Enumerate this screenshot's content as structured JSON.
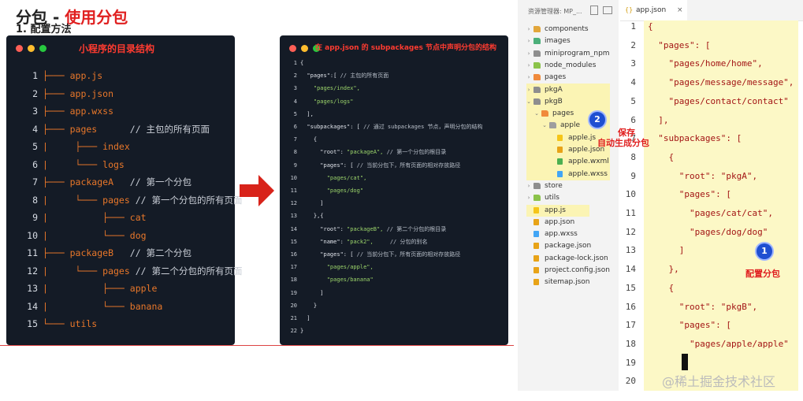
{
  "heading": {
    "part1": "分包 - ",
    "part2": "使用分包"
  },
  "subheading": "1. 配置方法",
  "panel1": {
    "title": "小程序的目录结构",
    "lines": [
      {
        "n": "1",
        "t": "├─── app.js",
        "c": ""
      },
      {
        "n": "2",
        "t": "├─── app.json",
        "c": ""
      },
      {
        "n": "3",
        "t": "├─── app.wxss",
        "c": ""
      },
      {
        "n": "4",
        "t": "├─── pages      ",
        "c": "// 主包的所有页面"
      },
      {
        "n": "5",
        "t": "|     ├─── index",
        "c": ""
      },
      {
        "n": "6",
        "t": "|     └─── logs",
        "c": ""
      },
      {
        "n": "7",
        "t": "├─── packageA   ",
        "c": "// 第一个分包"
      },
      {
        "n": "8",
        "t": "|     └─── pages ",
        "c": "// 第一个分包的所有页面"
      },
      {
        "n": "9",
        "t": "|          ├─── cat",
        "c": ""
      },
      {
        "n": "10",
        "t": "|          └─── dog",
        "c": ""
      },
      {
        "n": "11",
        "t": "├─── packageB   ",
        "c": "// 第二个分包"
      },
      {
        "n": "12",
        "t": "|     └─── pages ",
        "c": "// 第二个分包的所有页面"
      },
      {
        "n": "13",
        "t": "|          ├─── apple",
        "c": ""
      },
      {
        "n": "14",
        "t": "|          └─── banana",
        "c": ""
      },
      {
        "n": "15",
        "t": "└─── utils",
        "c": ""
      }
    ]
  },
  "panel2": {
    "title": "在 app.json 的 subpackages 节点中声明分包的结构",
    "lines": [
      {
        "n": "1",
        "a": "{",
        "s": "",
        "c": ""
      },
      {
        "n": "2",
        "a": "  \"pages\":[ ",
        "s": "",
        "c": "// 主包的所有页面"
      },
      {
        "n": "3",
        "a": "    ",
        "s": "\"pages/index\",",
        "c": ""
      },
      {
        "n": "4",
        "a": "    ",
        "s": "\"pages/logs\"",
        "c": ""
      },
      {
        "n": "5",
        "a": "  ],",
        "s": "",
        "c": ""
      },
      {
        "n": "6",
        "a": "  \"subpackages\": [ ",
        "s": "",
        "c": "// 通过 subpackages 节点，声明分包的结构"
      },
      {
        "n": "7",
        "a": "    {",
        "s": "",
        "c": ""
      },
      {
        "n": "8",
        "a": "      \"root\": ",
        "s": "\"packageA\", ",
        "c": "// 第一个分包的根目录"
      },
      {
        "n": "9",
        "a": "      \"pages\": [ ",
        "s": "",
        "c": "// 当前分包下，所有页面的相对存放路径"
      },
      {
        "n": "10",
        "a": "        ",
        "s": "\"pages/cat\",",
        "c": ""
      },
      {
        "n": "11",
        "a": "        ",
        "s": "\"pages/dog\"",
        "c": ""
      },
      {
        "n": "12",
        "a": "      ]",
        "s": "",
        "c": ""
      },
      {
        "n": "13",
        "a": "    },{",
        "s": "",
        "c": ""
      },
      {
        "n": "14",
        "a": "      \"root\": ",
        "s": "\"packageB\", ",
        "c": "// 第二个分包的根目录"
      },
      {
        "n": "15",
        "a": "      \"name\": ",
        "s": "\"pack2\",     ",
        "c": "// 分包的别名"
      },
      {
        "n": "16",
        "a": "      \"pages\": [ ",
        "s": "",
        "c": "// 当前分包下，所有页面的相对存放路径"
      },
      {
        "n": "17",
        "a": "        ",
        "s": "\"pages/apple\",",
        "c": ""
      },
      {
        "n": "18",
        "a": "        ",
        "s": "\"pages/banana\"",
        "c": ""
      },
      {
        "n": "19",
        "a": "      ]",
        "s": "",
        "c": ""
      },
      {
        "n": "20",
        "a": "    }",
        "s": "",
        "c": ""
      },
      {
        "n": "21",
        "a": "  ]",
        "s": "",
        "c": ""
      },
      {
        "n": "22",
        "a": "}",
        "s": "",
        "c": ""
      }
    ]
  },
  "explorer": {
    "header": "资源管理器: MP_...",
    "items": [
      {
        "label": "components",
        "depth": 0,
        "chev": "›",
        "icon": "folder",
        "color": "#e2a63b"
      },
      {
        "label": "images",
        "depth": 0,
        "chev": "›",
        "icon": "folder",
        "color": "#4caf7a"
      },
      {
        "label": "miniprogram_npm",
        "depth": 0,
        "chev": "›",
        "icon": "folder",
        "color": "#8e8e8e"
      },
      {
        "label": "node_modules",
        "depth": 0,
        "chev": "›",
        "icon": "folder",
        "color": "#8bc34a"
      },
      {
        "label": "pages",
        "depth": 0,
        "chev": "›",
        "icon": "folder",
        "color": "#f08a3c"
      },
      {
        "label": "pkgA",
        "depth": 0,
        "chev": "›",
        "icon": "folder",
        "color": "#8e8e8e"
      },
      {
        "label": "pkgB",
        "depth": 0,
        "chev": "⌄",
        "icon": "folder",
        "color": "#8e8e8e"
      },
      {
        "label": "pages",
        "depth": 1,
        "chev": "⌄",
        "icon": "folder",
        "color": "#f08a3c"
      },
      {
        "label": "apple",
        "depth": 2,
        "chev": "⌄",
        "icon": "folder",
        "color": "#9e9e9e"
      },
      {
        "label": "apple.js",
        "depth": 3,
        "chev": "",
        "icon": "file",
        "color": "#f5c518"
      },
      {
        "label": "apple.json",
        "depth": 3,
        "chev": "",
        "icon": "file",
        "color": "#e8a317"
      },
      {
        "label": "apple.wxml",
        "depth": 3,
        "chev": "",
        "icon": "file",
        "color": "#4caf50"
      },
      {
        "label": "apple.wxss",
        "depth": 3,
        "chev": "",
        "icon": "file",
        "color": "#42a5f5"
      },
      {
        "label": "store",
        "depth": 0,
        "chev": "›",
        "icon": "folder",
        "color": "#8e8e8e"
      },
      {
        "label": "utils",
        "depth": 0,
        "chev": "›",
        "icon": "folder",
        "color": "#8bc34a"
      },
      {
        "label": "app.js",
        "depth": 0,
        "chev": "",
        "icon": "file",
        "color": "#f5c518"
      },
      {
        "label": "app.json",
        "depth": 0,
        "chev": "",
        "icon": "file",
        "color": "#e8a317"
      },
      {
        "label": "app.wxss",
        "depth": 0,
        "chev": "",
        "icon": "file",
        "color": "#42a5f5"
      },
      {
        "label": "package.json",
        "depth": 0,
        "chev": "",
        "icon": "file",
        "color": "#e8a317"
      },
      {
        "label": "package-lock.json",
        "depth": 0,
        "chev": "",
        "icon": "file",
        "color": "#e8a317"
      },
      {
        "label": "project.config.json",
        "depth": 0,
        "chev": "",
        "icon": "file",
        "color": "#e8a317"
      },
      {
        "label": "sitemap.json",
        "depth": 0,
        "chev": "",
        "icon": "file",
        "color": "#e8a317"
      }
    ]
  },
  "editor": {
    "tab_label": "app.json",
    "lines": [
      {
        "n": "1",
        "t": "{"
      },
      {
        "n": "2",
        "t": "  \"pages\": ["
      },
      {
        "n": "3",
        "t": "    \"pages/home/home\","
      },
      {
        "n": "4",
        "t": "    \"pages/message/message\","
      },
      {
        "n": "5",
        "t": "    \"pages/contact/contact\""
      },
      {
        "n": "6",
        "t": "  ],"
      },
      {
        "n": "7",
        "t": "  \"subpackages\": ["
      },
      {
        "n": "8",
        "t": "    {"
      },
      {
        "n": "9",
        "t": "      \"root\": \"pkgA\","
      },
      {
        "n": "10",
        "t": "      \"pages\": ["
      },
      {
        "n": "11",
        "t": "        \"pages/cat/cat\","
      },
      {
        "n": "12",
        "t": "        \"pages/dog/dog\""
      },
      {
        "n": "13",
        "t": "      ]"
      },
      {
        "n": "14",
        "t": "    },"
      },
      {
        "n": "15",
        "t": "    {"
      },
      {
        "n": "16",
        "t": "      \"root\": \"pkgB\","
      },
      {
        "n": "17",
        "t": "      \"pages\": ["
      },
      {
        "n": "18",
        "t": "        \"pages/apple/apple\""
      },
      {
        "n": "19",
        "t": ""
      },
      {
        "n": "20",
        "t": ""
      }
    ]
  },
  "callouts": {
    "badge1": "1",
    "badge2": "2",
    "text1": "配置分包",
    "text2_line1": "保存",
    "text2_line2": "自动生成分包"
  },
  "watermark": "@稀土掘金技术社区"
}
